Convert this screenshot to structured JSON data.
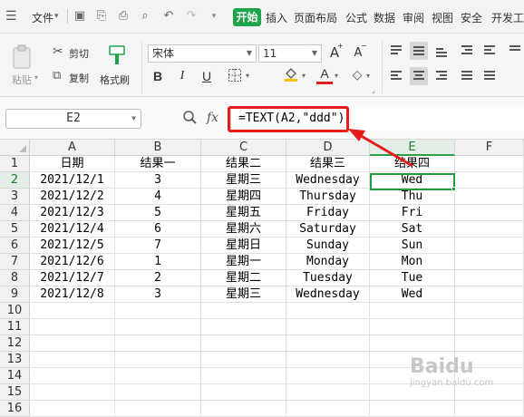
{
  "menu": {
    "file": "文件",
    "tabs": [
      "开始",
      "插入",
      "页面布局",
      "公式",
      "数据",
      "审阅",
      "视图",
      "安全",
      "开发工"
    ]
  },
  "ribbon": {
    "paste": "粘贴",
    "cut": "剪切",
    "copy": "复制",
    "format_painter": "格式刷",
    "font_name": "宋体",
    "font_size": "11",
    "grow_font": "A",
    "shrink_font": "A",
    "bold": "B",
    "italic": "I",
    "underline": "U",
    "font_color_letter": "A",
    "colors": {
      "fill": "#f5c400",
      "font": "#e02020",
      "accent": "#1fa34a"
    }
  },
  "formula_bar": {
    "name_box": "E2",
    "fx": "fx",
    "formula": "=TEXT(A2,\"ddd\")"
  },
  "sheet": {
    "columns": [
      "A",
      "B",
      "C",
      "D",
      "E",
      "F"
    ],
    "row_numbers": [
      "1",
      "2",
      "3",
      "4",
      "5",
      "6",
      "7",
      "8",
      "9",
      "10",
      "11",
      "12",
      "13",
      "14",
      "15",
      "16"
    ],
    "header_row": [
      "日期",
      "结果一",
      "结果二",
      "结果三",
      "结果四"
    ],
    "rows": [
      [
        "2021/12/1",
        "3",
        "星期三",
        "Wednesday",
        "Wed"
      ],
      [
        "2021/12/2",
        "4",
        "星期四",
        "Thursday",
        "Thu"
      ],
      [
        "2021/12/3",
        "5",
        "星期五",
        "Friday",
        "Fri"
      ],
      [
        "2021/12/4",
        "6",
        "星期六",
        "Saturday",
        "Sat"
      ],
      [
        "2021/12/5",
        "7",
        "星期日",
        "Sunday",
        "Sun"
      ],
      [
        "2021/12/6",
        "1",
        "星期一",
        "Monday",
        "Mon"
      ],
      [
        "2021/12/7",
        "2",
        "星期二",
        "Tuesday",
        "Tue"
      ],
      [
        "2021/12/8",
        "3",
        "星期三",
        "Wednesday",
        "Wed"
      ]
    ],
    "active_cell": "E2"
  },
  "watermark": {
    "text": "Baidu",
    "sub": "jingyan.baidu.com"
  }
}
